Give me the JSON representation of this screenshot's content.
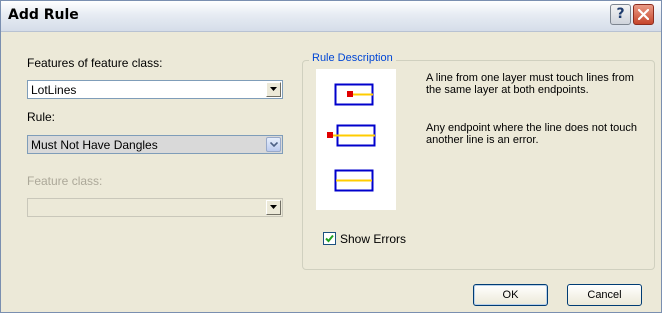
{
  "dialog": {
    "title": "Add Rule"
  },
  "title_buttons": {
    "help_label": "?"
  },
  "form": {
    "features_label": "Features of feature class:",
    "features_value": "LotLines",
    "rule_label": "Rule:",
    "rule_value": "Must Not Have Dangles",
    "feature_class_label": "Feature class:",
    "feature_class_value": ""
  },
  "rule_description": {
    "title": "Rule Description",
    "text1": "A line from one layer must touch lines from the same layer at both endpoints.",
    "text2": "Any endpoint where the line does not touch another line is an error.",
    "show_errors_label": "Show Errors",
    "show_errors_checked": true
  },
  "buttons": {
    "ok": "OK",
    "cancel": "Cancel"
  },
  "colors": {
    "outline": "#0000cc",
    "line": "#ffcc00",
    "error": "#e00000",
    "accent": "#0046d5"
  }
}
